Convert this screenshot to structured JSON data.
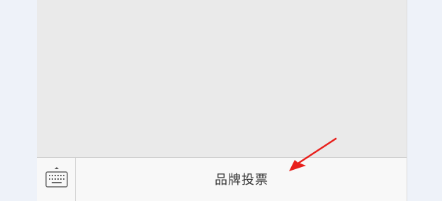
{
  "icons": {
    "keyboard_toggle": "keyboard-icon",
    "expand_caret": "caret-up-icon",
    "annotation": "red-arrow-icon"
  },
  "colors": {
    "background": "#eef2f9",
    "content": "#eaeaea",
    "menu_bar": "#f8f8f8",
    "menu_text": "#333333",
    "arrow": "#e8201c"
  },
  "menu": {
    "items": [
      {
        "label": "品牌投票"
      }
    ]
  }
}
